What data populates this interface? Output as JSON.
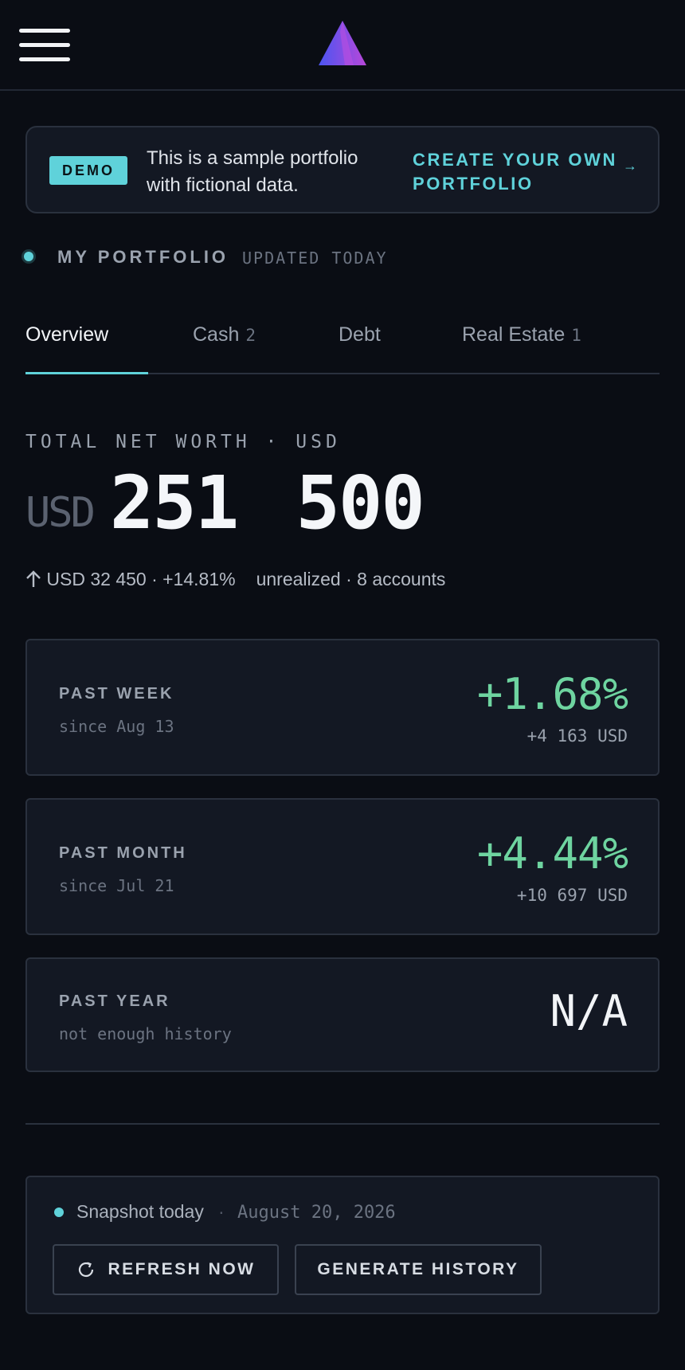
{
  "header": {
    "menu_icon": "hamburger-menu-icon",
    "logo_icon": "triangle-logo-icon",
    "logo_colors": [
      "#5b4ff0",
      "#b044d8"
    ]
  },
  "demo_banner": {
    "badge": "DEMO",
    "text": "This is a sample portfolio with fictional data.",
    "cta": "CREATE YOUR OWN PORTFOLIO",
    "cta_icon": "arrow-right-icon"
  },
  "portfolio": {
    "title": "MY PORTFOLIO",
    "updated": "UPDATED TODAY"
  },
  "tabs": [
    {
      "label": "Overview",
      "count": "",
      "active": true
    },
    {
      "label": "Cash",
      "count": "2",
      "active": false
    },
    {
      "label": "Debt",
      "count": "",
      "active": false
    },
    {
      "label": "Real Estate",
      "count": "1",
      "active": false
    }
  ],
  "net_worth": {
    "label": "TOTAL NET WORTH · USD",
    "currency": "USD",
    "value": "251 500",
    "change_icon": "arrow-up-icon",
    "change": "USD 32 450 · +14.81%",
    "details": "unrealized · 8 accounts"
  },
  "periods": [
    {
      "title": "PAST WEEK",
      "sub": "since Aug 13",
      "pct": "+1.68%",
      "abs": "+4 163 USD"
    },
    {
      "title": "PAST MONTH",
      "sub": "since Jul 21",
      "pct": "+4.44%",
      "abs": "+10 697 USD"
    },
    {
      "title": "PAST YEAR",
      "sub": "not enough history",
      "value": "N/A"
    }
  ],
  "snapshot": {
    "label": "Snapshot today",
    "separator": "·",
    "date": "August 20, 2026",
    "refresh_label": "REFRESH NOW",
    "refresh_icon": "refresh-icon",
    "generate_label": "GENERATE HISTORY"
  },
  "colors": {
    "background": "#0a0d14",
    "card": "#131823",
    "accent": "#5fd2da",
    "positive": "#6ed4a0"
  }
}
